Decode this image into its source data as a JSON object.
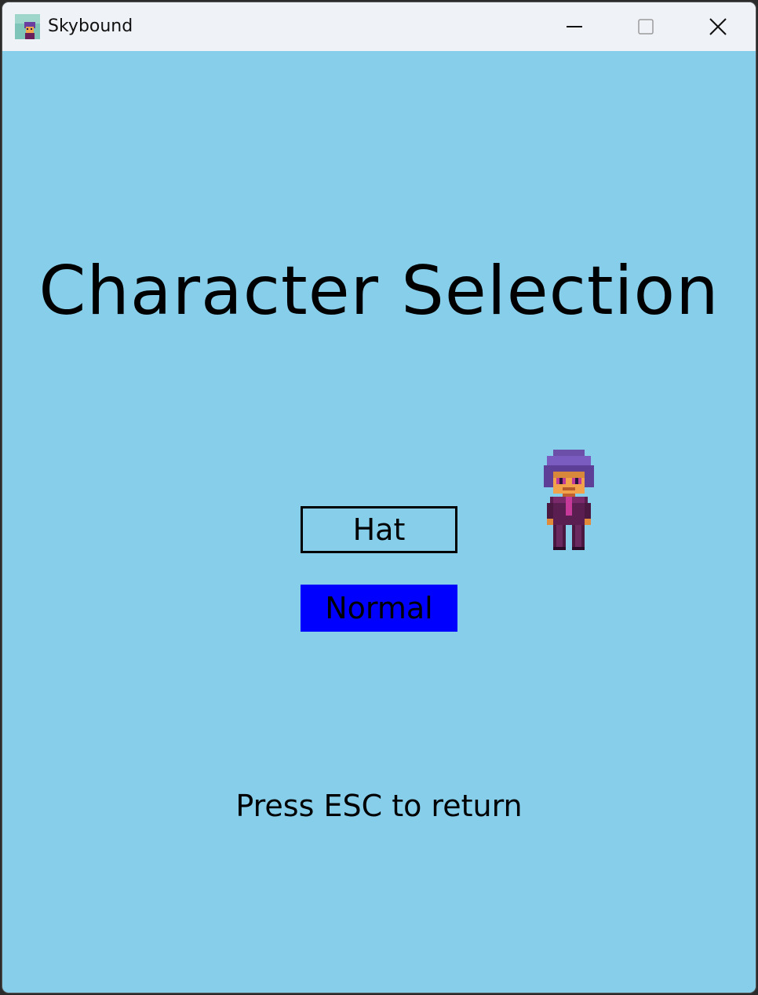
{
  "window": {
    "title": "Skybound",
    "app_icon": "character-portrait-icon",
    "controls": {
      "minimize_icon": "minimize-icon",
      "maximize_icon": "maximize-icon",
      "close_icon": "close-icon"
    }
  },
  "screen": {
    "heading": "Character Selection",
    "options": [
      {
        "label": "Hat",
        "selected": false
      },
      {
        "label": "Normal",
        "selected": true
      }
    ],
    "preview_sprite": "character-sprite",
    "hint": "Press ESC to return"
  },
  "colors": {
    "background": "#87ceeb",
    "titlebar": "#eff3f8",
    "selected_option": "#0000ff",
    "text": "#000000"
  }
}
